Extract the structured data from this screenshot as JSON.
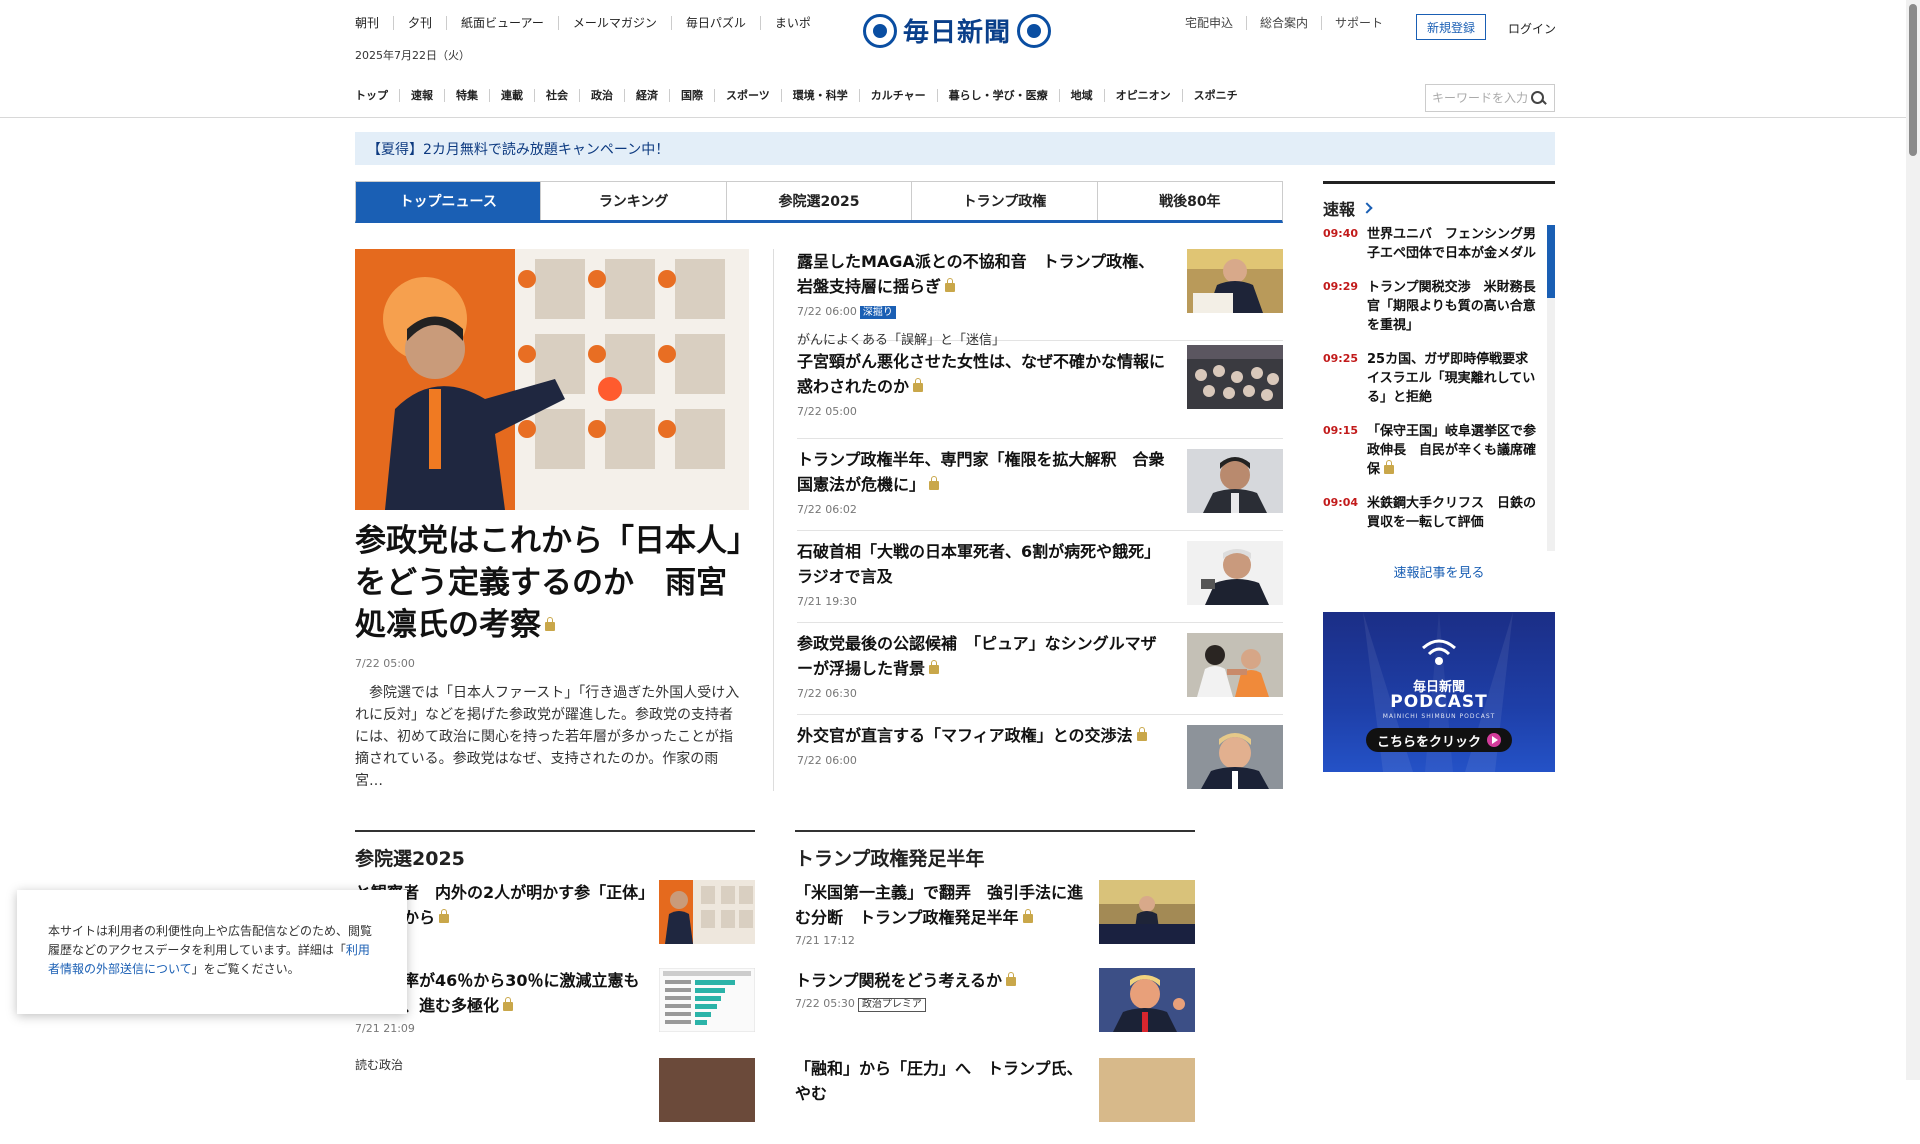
{
  "header": {
    "util_links": [
      "朝刊",
      "夕刊",
      "紙面ビューアー",
      "メールマガジン",
      "毎日パズル",
      "まいポ"
    ],
    "date": "2025年7月22日（火）",
    "logo_text": "毎日新聞",
    "right_links": [
      "宅配申込",
      "総合案内",
      "サポート"
    ],
    "signup": "新規登録",
    "login": "ログイン",
    "nav": [
      "トップ",
      "速報",
      "特集",
      "連載",
      "社会",
      "政治",
      "経済",
      "国際",
      "スポーツ",
      "環境・科学",
      "カルチャー",
      "暮らし・学び・医療",
      "地域",
      "オピニオン",
      "スポニチ"
    ],
    "search_placeholder": "キーワードを入力"
  },
  "campaign": "【夏得】2カ月無料で読み放題キャンペーン中！",
  "tabs": [
    "トップニュース",
    "ランキング",
    "参院選2025",
    "トランプ政権",
    "戦後80年"
  ],
  "hero": {
    "title": "参政党はこれから「日本人」をどう定義するのか　雨宮処凛氏の考察",
    "time": "7/22 05:00",
    "summary": "参院選では「日本人ファースト」「行き過ぎた外国人受け入れに反対」などを掲げた参政党が躍進した。参政党の支持者には、初めて政治に関心を持った若年層が多かったことが指摘されている。参政党はなぜ、支持されたのか。作家の雨宮…"
  },
  "articles": [
    {
      "sub": "",
      "title": "露呈したMAGA派との不協和音　トランプ政権、岩盤支持層に揺らぎ",
      "time": "7/22 06:00",
      "badge": "深掘り"
    },
    {
      "sub": "がんによくある「誤解」と「迷信」",
      "title": "子宮頸がん悪化させた女性は、なぜ不確かな情報に惑わされたのか",
      "time": "7/22 05:00",
      "badge": ""
    },
    {
      "sub": "",
      "title": "トランプ政権半年、専門家「権限を拡大解釈　合衆国憲法が危機に」",
      "time": "7/22 06:02",
      "badge": ""
    },
    {
      "sub": "",
      "title": "石破首相「大戦の日本軍死者、6割が病死や餓死」ラジオで言及",
      "time": "7/21 19:30",
      "badge": ""
    },
    {
      "sub": "",
      "title": "参政党最後の公認候補　「ピュア」なシングルマザーが浮揚した背景",
      "time": "7/22 06:30",
      "badge": ""
    },
    {
      "sub": "",
      "title": "外交官が直言する「マフィア政権」との交渉法",
      "time": "7/22 06:00",
      "badge": ""
    }
  ],
  "flash": {
    "title": "速報",
    "items": [
      {
        "time": "09:40",
        "text": "世界ユニバ　フェンシング男子エペ団体で日本が金メダル"
      },
      {
        "time": "09:29",
        "text": "トランプ関税交渉　米財務長官「期限よりも質の高い合意を重視」"
      },
      {
        "time": "09:25",
        "text": "25カ国、ガザ即時停戦要求　イスラエル「現実離れしている」と拒絶"
      },
      {
        "time": "09:15",
        "text": "「保守王国」岐阜選挙区で参政伸長　自民が辛くも議席確保"
      },
      {
        "time": "09:04",
        "text": "米鉄鋼大手クリフス　日鉄の買収を一転して評価"
      }
    ],
    "more": "速報記事を見る"
  },
  "podcast": {
    "line1": "毎日新聞",
    "line2": "PODCAST",
    "line3": "MAINICHI SHIMBUN PODCAST",
    "cta": "こちらをクリック"
  },
  "sections": [
    {
      "title": "参院選2025",
      "items": [
        {
          "sub": "",
          "title": "と観察者　内外の2人が明かす参「正体」とこれから",
          "time": "",
          "badge": ""
        },
        {
          "sub": "",
          "title": "例得票率が46％から30％に激減立憲も横ばい、進む多極化",
          "time": "7/21 21:09",
          "badge": ""
        },
        {
          "sub": "読む政治",
          "title": "",
          "time": "",
          "badge": ""
        }
      ]
    },
    {
      "title": "トランプ政権発足半年",
      "items": [
        {
          "sub": "",
          "title": "「米国第一主義」で翻弄　強引手法に進む分断　トランプ政権発足半年",
          "time": "7/21 17:12",
          "badge": ""
        },
        {
          "sub": "",
          "title": "トランプ関税をどう考えるか",
          "time": "7/22 05:30",
          "badge": "政治プレミア"
        },
        {
          "sub": "",
          "title": "「融和」から「圧力」へ　トランプ氏、やむ",
          "time": "",
          "badge": ""
        }
      ]
    }
  ],
  "cookie": {
    "text1": "本サイトは利用者の利便性向上や広告配信などのため、閲覧履歴などのアクセスデータを利用しています。詳細は「",
    "link": "利用者情報の外部送信について",
    "text2": "」をご覧ください。"
  },
  "colors": {
    "accent": "#1a5fb4",
    "flash_time": "#c21b1b",
    "campaign_bg": "#e3eef8",
    "lock": "#c9a74a"
  }
}
